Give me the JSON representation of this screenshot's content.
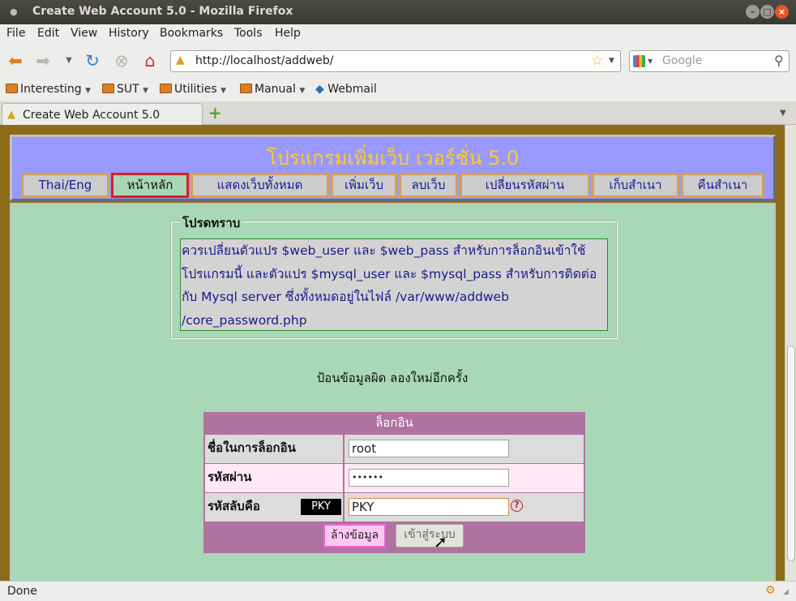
{
  "window": {
    "title": "Create Web Account 5.0 - Mozilla Firefox"
  },
  "menu": [
    "File",
    "Edit",
    "View",
    "History",
    "Bookmarks",
    "Tools",
    "Help"
  ],
  "address": {
    "url": "http://localhost/addweb/"
  },
  "search": {
    "placeholder": "Google"
  },
  "bookmarks": [
    "Interesting",
    "SUT",
    "Utilities",
    "Manual",
    "Webmail"
  ],
  "tab": {
    "title": "Create Web Account 5.0"
  },
  "page": {
    "title": "โปรแกรมเพิ่มเว็บ เวอร์ชั่น 5.0",
    "nav": [
      "Thai/Eng",
      "หน้าหลัก",
      "แสดงเว็บทั้งหมด",
      "เพิ่มเว็บ",
      "ลบเว็บ",
      "เปลี่ยนรหัสผ่าน",
      "เก็บสำเนา",
      "คืนสำเนา"
    ],
    "notice": {
      "legend": "โปรดทราบ",
      "lines": [
        "ควรเปลี่ยนตัวแปร $web_user และ $web_pass สำหรับการล็อกอินเข้าใช้",
        "โปรแกรมนี้ และตัวแปร $mysql_user และ $mysql_pass สำหรับการติดต่อ",
        "กับ Mysql server ซึ่งทั้งหมดอยู่ในไฟล์ /var/www/addweb",
        "/core_password.php"
      ]
    },
    "error": "ป้อนข้อมูลผิด ลองใหม่อีกครั้ง",
    "login": {
      "header": "ล็อกอิน",
      "username_label": "ชื่อในการล็อกอิน",
      "username_value": "root",
      "password_label": "รหัสผ่าน",
      "password_value": "••••••",
      "captcha_label": "รหัสลับคือ",
      "captcha_code": "PKY",
      "captcha_value": "PKY",
      "clear_button": "ล้างข้อมูล",
      "submit_button": "เข้าสู่ระบบ"
    }
  },
  "status": {
    "text": "Done"
  }
}
